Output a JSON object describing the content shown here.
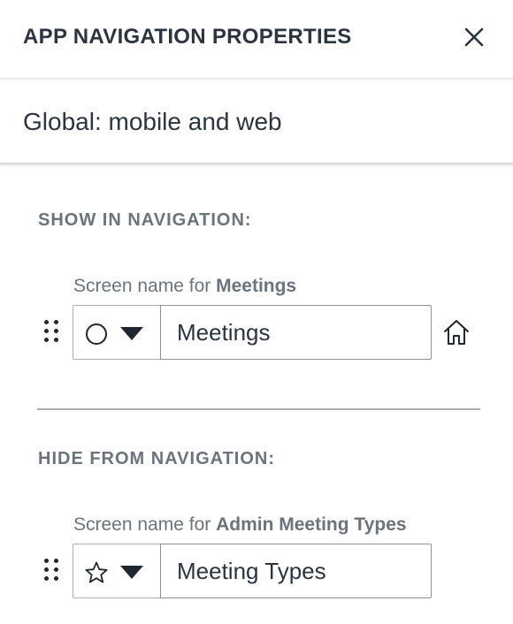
{
  "header": {
    "title": "APP NAVIGATION PROPERTIES",
    "close_icon": "close-icon"
  },
  "scope": {
    "label": "Global: mobile and web"
  },
  "show_section": {
    "label": "SHOW IN NAVIGATION:",
    "items": [
      {
        "caption_prefix": "Screen name for ",
        "caption_entity": "Meetings",
        "icon": "circle-icon",
        "value": "Meetings",
        "is_home": true
      }
    ]
  },
  "hide_section": {
    "label": "HIDE FROM NAVIGATION:",
    "items": [
      {
        "caption_prefix": "Screen name for ",
        "caption_entity": "Admin Meeting Types",
        "icon": "star-icon",
        "value": "Meeting Types"
      }
    ]
  },
  "colors": {
    "text": "#2b3440",
    "muted": "#6b737c",
    "border": "#a9afb6"
  }
}
